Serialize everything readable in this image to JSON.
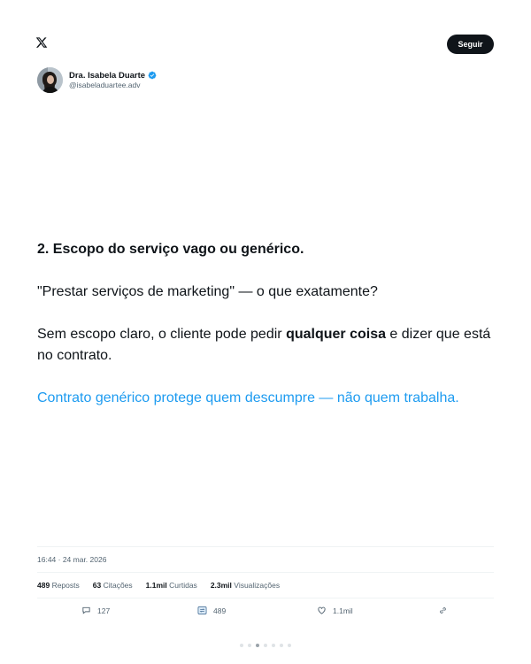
{
  "header": {
    "logo_icon": "x-logo-icon",
    "follow_label": "Seguir"
  },
  "profile": {
    "display_name": "Dra. Isabela Duarte",
    "handle": "@isabeladuartee.adv",
    "verified_icon": "verified-badge-icon",
    "verified_color": "#1d9bf0"
  },
  "post": {
    "heading": "2. Escopo do serviço vago ou genérico.",
    "quote": "\"Prestar serviços de marketing\" — o que exatamente?",
    "body_before": "Sem escopo claro, o cliente pode pedir ",
    "body_bold": "qualquer coisa",
    "body_after": " e dizer que está no contrato.",
    "highlight": "Contrato genérico protege quem descumpre — não quem trabalha.",
    "highlight_color": "#1d9bf0"
  },
  "meta": {
    "timestamp": "16:44 · 24 mar. 2026"
  },
  "stats": [
    {
      "value": "489",
      "label": "Reposts"
    },
    {
      "value": "63",
      "label": "Citações"
    },
    {
      "value": "1.1mil",
      "label": "Curtidas"
    },
    {
      "value": "2.3mil",
      "label": "Visualizações"
    }
  ],
  "actions": {
    "reply": {
      "icon": "reply-icon",
      "count": "127"
    },
    "repost": {
      "icon": "repost-icon",
      "count": "489"
    },
    "like": {
      "icon": "heart-icon",
      "count": "1.1mil"
    },
    "share": {
      "icon": "link-icon"
    }
  },
  "pagination": {
    "total": 7,
    "current": 3
  }
}
